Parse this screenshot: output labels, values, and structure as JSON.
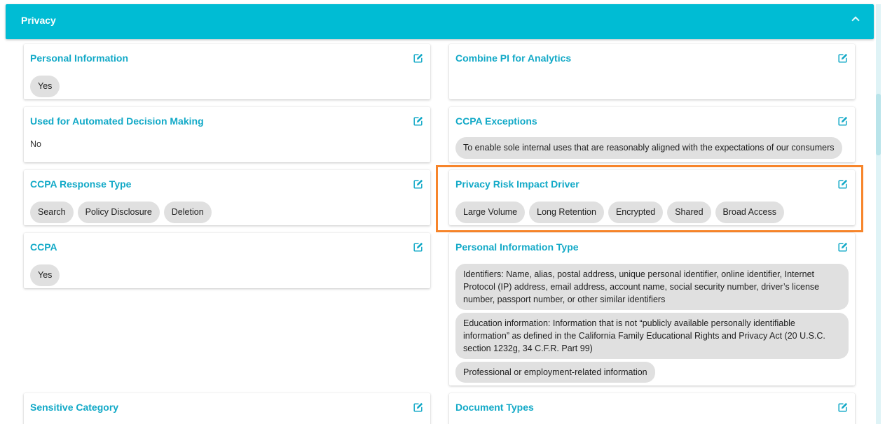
{
  "section": {
    "title": "Privacy"
  },
  "colors": {
    "header": "#00bcd4",
    "title": "#12a9c7",
    "chip": "#e0e0e0",
    "highlight": "#f7852b"
  },
  "icons": {
    "edit": "edit-icon",
    "collapse": "chevron-up-icon"
  },
  "cards": {
    "personal_information": {
      "title": "Personal Information",
      "chips": [
        "Yes"
      ]
    },
    "combine_pi": {
      "title": "Combine PI for Analytics"
    },
    "automated_decision": {
      "title": "Used for Automated Decision Making",
      "value": "No"
    },
    "ccpa_exceptions": {
      "title": "CCPA Exceptions",
      "chips": [
        "To enable sole internal uses that are reasonably aligned with the expectations of our consumers"
      ]
    },
    "ccpa_response_type": {
      "title": "CCPA Response Type",
      "chips": [
        "Search",
        "Policy Disclosure",
        "Deletion"
      ]
    },
    "privacy_risk": {
      "title": "Privacy Risk Impact Driver",
      "chips": [
        "Large Volume",
        "Long Retention",
        "Encrypted",
        "Shared",
        "Broad Access"
      ]
    },
    "ccpa": {
      "title": "CCPA",
      "chips": [
        "Yes"
      ]
    },
    "pi_type": {
      "title": "Personal Information Type",
      "chips": [
        "Identifiers: Name, alias, postal address, unique personal identifier, online identifier, Internet Protocol (IP) address, email address, account name, social security number, driver’s license number, passport number, or other similar identifiers",
        "Education information: Information that is not “publicly available personally identifiable information” as defined in the California Family Educational Rights and Privacy Act (20 U.S.C. section 1232g, 34 C.F.R. Part 99)",
        "Professional or employment-related information"
      ]
    },
    "sensitive_category": {
      "title": "Sensitive Category"
    },
    "document_types": {
      "title": "Document Types"
    }
  }
}
